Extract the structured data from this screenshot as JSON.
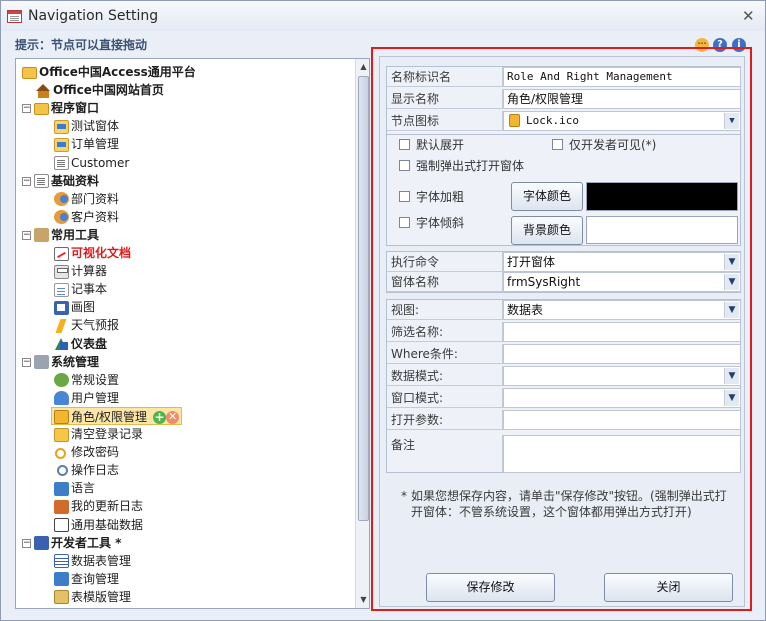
{
  "window": {
    "title": "Navigation Setting",
    "close_glyph": "✕"
  },
  "hint": "提示：节点可以直接拖动",
  "top_icons": [
    "more-icon",
    "help-icon",
    "info-icon"
  ],
  "tree": {
    "nodes": [
      {
        "label": "Office中国Access通用平台",
        "icon": "root-icon",
        "bold": true
      },
      {
        "label": "Office中国网站首页",
        "icon": "home-icon",
        "bold": true
      },
      {
        "label": "程序窗口",
        "icon": "folder-icon",
        "bold": true,
        "expander": "−"
      },
      {
        "label": "测试窗体",
        "icon": "form-icon"
      },
      {
        "label": "订单管理",
        "icon": "order-icon"
      },
      {
        "label": "Customer",
        "icon": "doc-icon"
      },
      {
        "label": "基础资料",
        "icon": "book-icon",
        "bold": true,
        "expander": "−"
      },
      {
        "label": "部门资料",
        "icon": "dept-icon"
      },
      {
        "label": "客户资料",
        "icon": "customer-icon"
      },
      {
        "label": "常用工具",
        "icon": "tools-icon",
        "bold": true,
        "expander": "−"
      },
      {
        "label": "可视化文档",
        "icon": "graph-icon",
        "red": true
      },
      {
        "label": "计算器",
        "icon": "calculator-icon"
      },
      {
        "label": "记事本",
        "icon": "notepad-icon"
      },
      {
        "label": "画图",
        "icon": "paint-icon"
      },
      {
        "label": "天气预报",
        "icon": "weather-icon"
      },
      {
        "label": "仪表盘",
        "icon": "dashboard-icon",
        "bold": true
      },
      {
        "label": "系统管理",
        "icon": "system-icon",
        "bold": true,
        "expander": "−"
      },
      {
        "label": "常规设置",
        "icon": "settings-icon"
      },
      {
        "label": "用户管理",
        "icon": "user-icon"
      },
      {
        "label": "角色/权限管理",
        "icon": "lock-icon",
        "selected": true
      },
      {
        "label": "清空登录记录",
        "icon": "clear-icon"
      },
      {
        "label": "修改密码",
        "icon": "key-icon"
      },
      {
        "label": "操作日志",
        "icon": "search-icon"
      },
      {
        "label": "语言",
        "icon": "language-icon"
      },
      {
        "label": "我的更新日志",
        "icon": "update-icon"
      },
      {
        "label": "通用基础数据",
        "icon": "base-data-icon"
      },
      {
        "label": "开发者工具  *",
        "icon": "dev-icon",
        "bold": true,
        "expander": "−"
      },
      {
        "label": "数据表管理",
        "icon": "table-icon"
      },
      {
        "label": "查询管理",
        "icon": "query-icon"
      },
      {
        "label": "表模版管理",
        "icon": "template-icon"
      }
    ],
    "node_add": "+",
    "node_del": "✕"
  },
  "form": {
    "labels": {
      "name_id": "名称标识名",
      "display_name": "显示名称",
      "node_icon": "节点图标",
      "command": "执行命令",
      "form_name": "窗体名称",
      "view": "视图:",
      "filter": "筛选名称:",
      "where": "Where条件:",
      "data_mode": "数据模式:",
      "window_mode": "窗口模式:",
      "open_args": "打开参数:",
      "remark": "备注"
    },
    "values": {
      "name_id": "Role And Right Management",
      "display_name": "角色/权限管理",
      "node_icon": "Lock.ico",
      "command": "打开窗体",
      "form_name": "frmSysRight",
      "view": "数据表",
      "filter": "",
      "where": "",
      "data_mode": "",
      "window_mode": "",
      "open_args": "",
      "remark": ""
    },
    "checkboxes": {
      "expand_default": "默认展开",
      "dev_only": "仅开发者可见(*)",
      "force_popup": "强制弹出式打开窗体",
      "bold": "字体加粗",
      "italic": "字体倾斜"
    },
    "buttons": {
      "font_color": "字体颜色",
      "bg_color": "背景颜色",
      "save": "保存修改",
      "close": "关闭"
    },
    "colors": {
      "font_color": "#000000",
      "bg_color": "#ffffff",
      "highlight": "#e01b1b"
    },
    "note_star": "*",
    "note": "如果您想保存内容，请单击\"保存修改\"按钮。(强制弹出式打开窗体：不管系统设置，这个窗体都用弹出方式打开)"
  }
}
